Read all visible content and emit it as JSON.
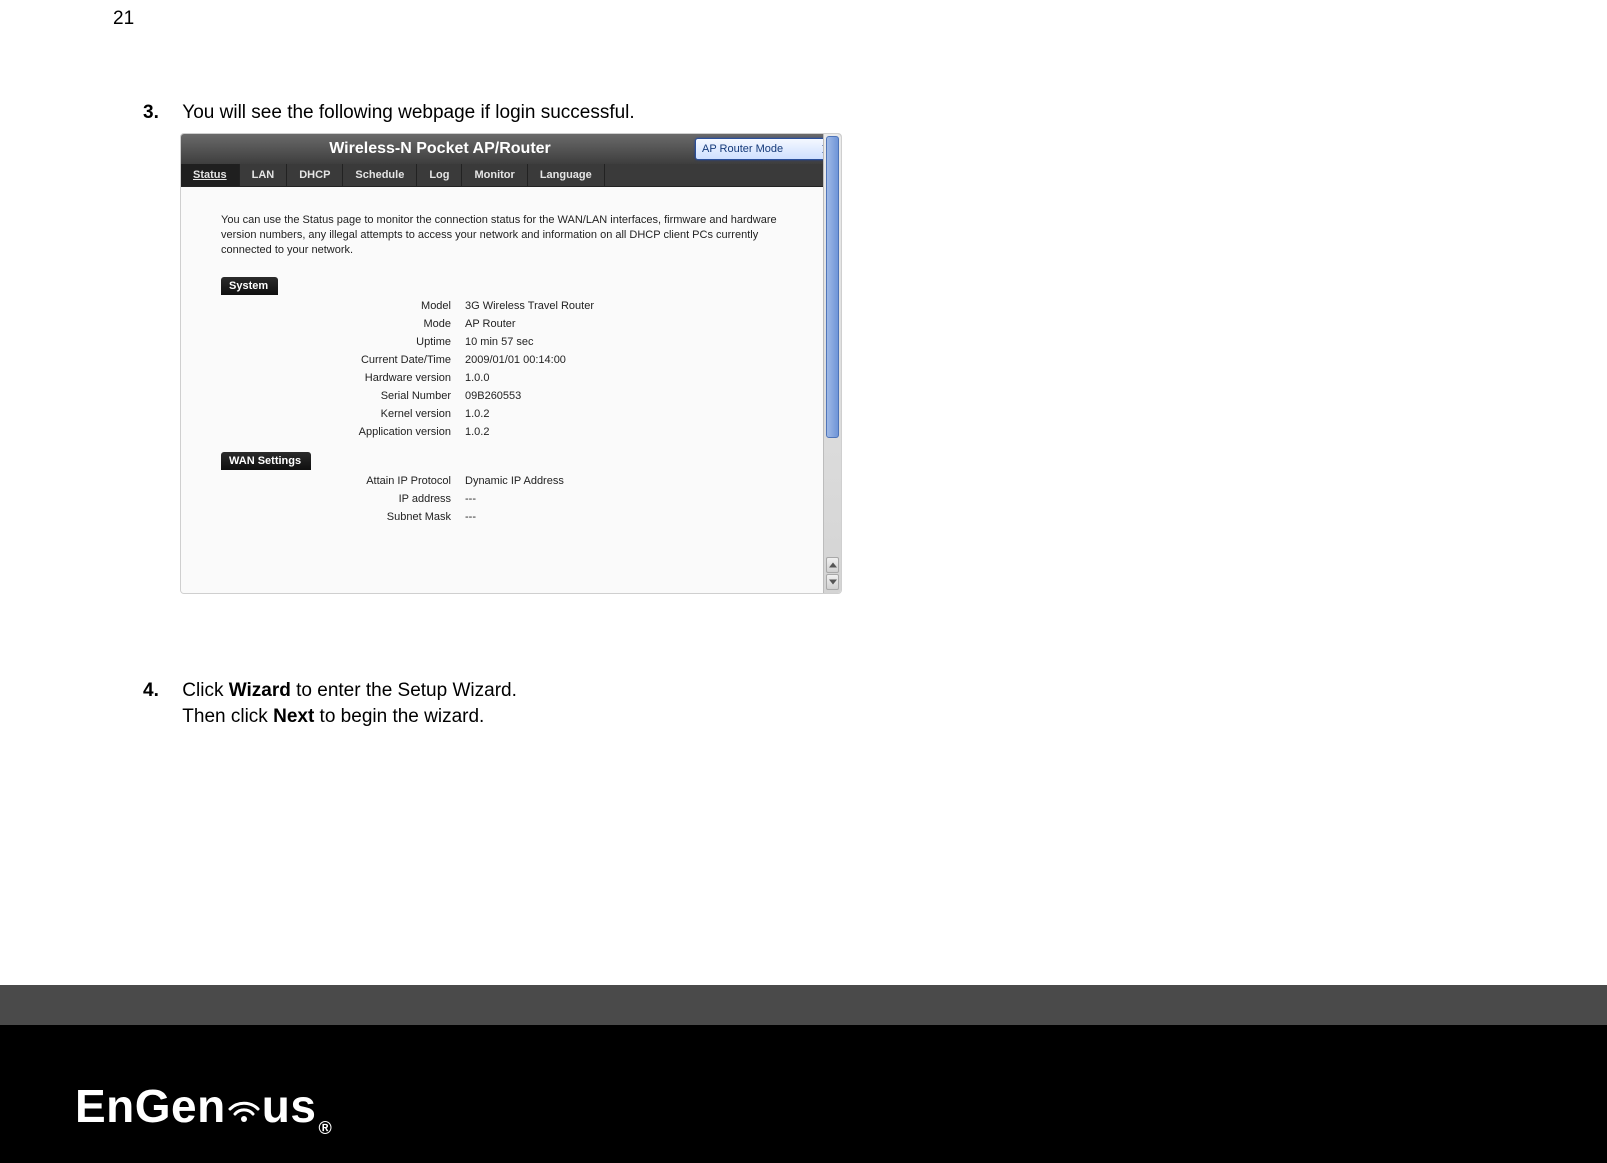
{
  "page_number": "21",
  "steps": {
    "s3": {
      "num": "3.",
      "text": "You will see the following webpage if login successful."
    },
    "s4": {
      "num": "4.",
      "line1_pre": "Click ",
      "line1_bold": "Wizard",
      "line1_post": " to enter the Setup Wizard.",
      "line2_pre": "Then click ",
      "line2_bold": "Next",
      "line2_post": " to begin the wizard."
    }
  },
  "screenshot": {
    "title": "Wireless-N Pocket AP/Router",
    "mode_selected": "AP Router Mode",
    "tabs": [
      "Status",
      "LAN",
      "DHCP",
      "Schedule",
      "Log",
      "Monitor",
      "Language"
    ],
    "active_tab_index": 0,
    "intro": "You can use the Status page to monitor the connection status for the WAN/LAN interfaces, firmware and hardware version numbers, any illegal attempts to access your network and information on all DHCP client PCs currently connected to your network.",
    "sections": [
      {
        "header": "System",
        "rows": [
          {
            "k": "Model",
            "v": "3G Wireless Travel Router"
          },
          {
            "k": "Mode",
            "v": "AP Router"
          },
          {
            "k": "Uptime",
            "v": "10 min 57 sec"
          },
          {
            "k": "Current Date/Time",
            "v": "2009/01/01 00:14:00"
          },
          {
            "k": "Hardware version",
            "v": "1.0.0"
          },
          {
            "k": "Serial Number",
            "v": "09B260553"
          },
          {
            "k": "Kernel version",
            "v": "1.0.2"
          },
          {
            "k": "Application version",
            "v": "1.0.2"
          }
        ]
      },
      {
        "header": "WAN Settings",
        "rows": [
          {
            "k": "Attain IP Protocol",
            "v": "Dynamic IP Address"
          },
          {
            "k": "IP address",
            "v": "---"
          },
          {
            "k": "Subnet Mask",
            "v": "---"
          }
        ]
      }
    ]
  },
  "logo": {
    "pre": "EnGen",
    "post": "us",
    "reg": "®"
  }
}
